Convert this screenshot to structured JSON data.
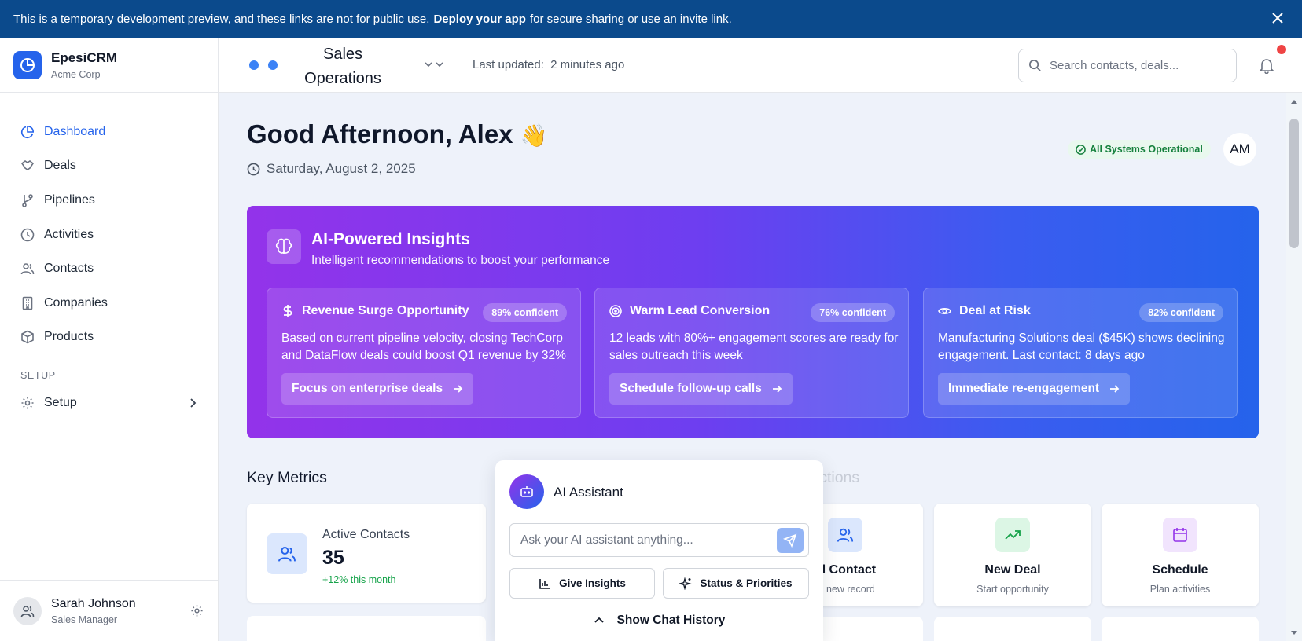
{
  "banner": {
    "text_before": "This is a temporary development preview, and these links are not for public use.",
    "link": "Deploy your app",
    "text_after": "for secure sharing or use an invite link."
  },
  "brand": {
    "name": "EpesiCRM",
    "org": "Acme Corp"
  },
  "sidebar": {
    "items": [
      {
        "label": "Dashboard",
        "icon": "pie-chart-icon",
        "active": true
      },
      {
        "label": "Deals",
        "icon": "handshake-icon"
      },
      {
        "label": "Pipelines",
        "icon": "git-branch-icon"
      },
      {
        "label": "Activities",
        "icon": "clock-icon"
      },
      {
        "label": "Contacts",
        "icon": "users-icon"
      },
      {
        "label": "Companies",
        "icon": "building-icon"
      },
      {
        "label": "Products",
        "icon": "box-icon"
      }
    ],
    "setup_section": "SETUP",
    "setup_label": "Setup"
  },
  "user": {
    "name": "Sarah Johnson",
    "role": "Sales Manager"
  },
  "topbar": {
    "workspace": "Sales Operations",
    "updated_label": "Last updated:",
    "updated_value": "2 minutes ago",
    "search_placeholder": "Search contacts, deals..."
  },
  "greeting": {
    "title": "Good Afternoon, Alex",
    "emoji": "👋",
    "date": "Saturday, August 2, 2025",
    "status": "All Systems Operational",
    "initials": "AM"
  },
  "insights": {
    "title": "AI-Powered Insights",
    "subtitle": "Intelligent recommendations to boost your performance",
    "cards": [
      {
        "icon": "dollar-icon",
        "title": "Revenue Surge Opportunity",
        "confidence": "89% confident",
        "body": "Based on current pipeline velocity, closing TechCorp and DataFlow deals could boost Q1 revenue by 32%",
        "action": "Focus on enterprise deals"
      },
      {
        "icon": "target-icon",
        "title": "Warm Lead Conversion",
        "confidence": "76% confident",
        "body": "12 leads with 80%+ engagement scores are ready for sales outreach this week",
        "action": "Schedule follow-up calls"
      },
      {
        "icon": "eye-icon",
        "title": "Deal at Risk",
        "confidence": "82% confident",
        "body": "Manufacturing Solutions deal ($45K) shows declining engagement. Last contact: 8 days ago",
        "action": "Immediate re-engagement"
      }
    ]
  },
  "metrics": {
    "heading": "Key Metrics",
    "active_contacts": {
      "label": "Active Contacts",
      "value": "35",
      "delta": "+12% this month"
    }
  },
  "quick_actions": {
    "heading": "Quick Actions",
    "items": [
      {
        "title": "ld Contact",
        "sub": "te new record",
        "icon": "users-icon",
        "bg": "#dbe7fd",
        "fg": "#2563eb"
      },
      {
        "title": "New Deal",
        "sub": "Start opportunity",
        "icon": "trending-up-icon",
        "bg": "#dcf6e5",
        "fg": "#16a34a"
      },
      {
        "title": "Schedule",
        "sub": "Plan activities",
        "icon": "calendar-icon",
        "bg": "#f1e4fd",
        "fg": "#9333ea"
      }
    ]
  },
  "assistant": {
    "title": "AI Assistant",
    "placeholder": "Ask your AI assistant anything...",
    "chip1": "Give Insights",
    "chip2": "Status & Priorities",
    "history": "Show Chat History"
  },
  "colors": {
    "accent": "#2563eb",
    "banner": "#0b4a8c",
    "gradient_start": "#9333ea",
    "gradient_end": "#2563eb"
  }
}
